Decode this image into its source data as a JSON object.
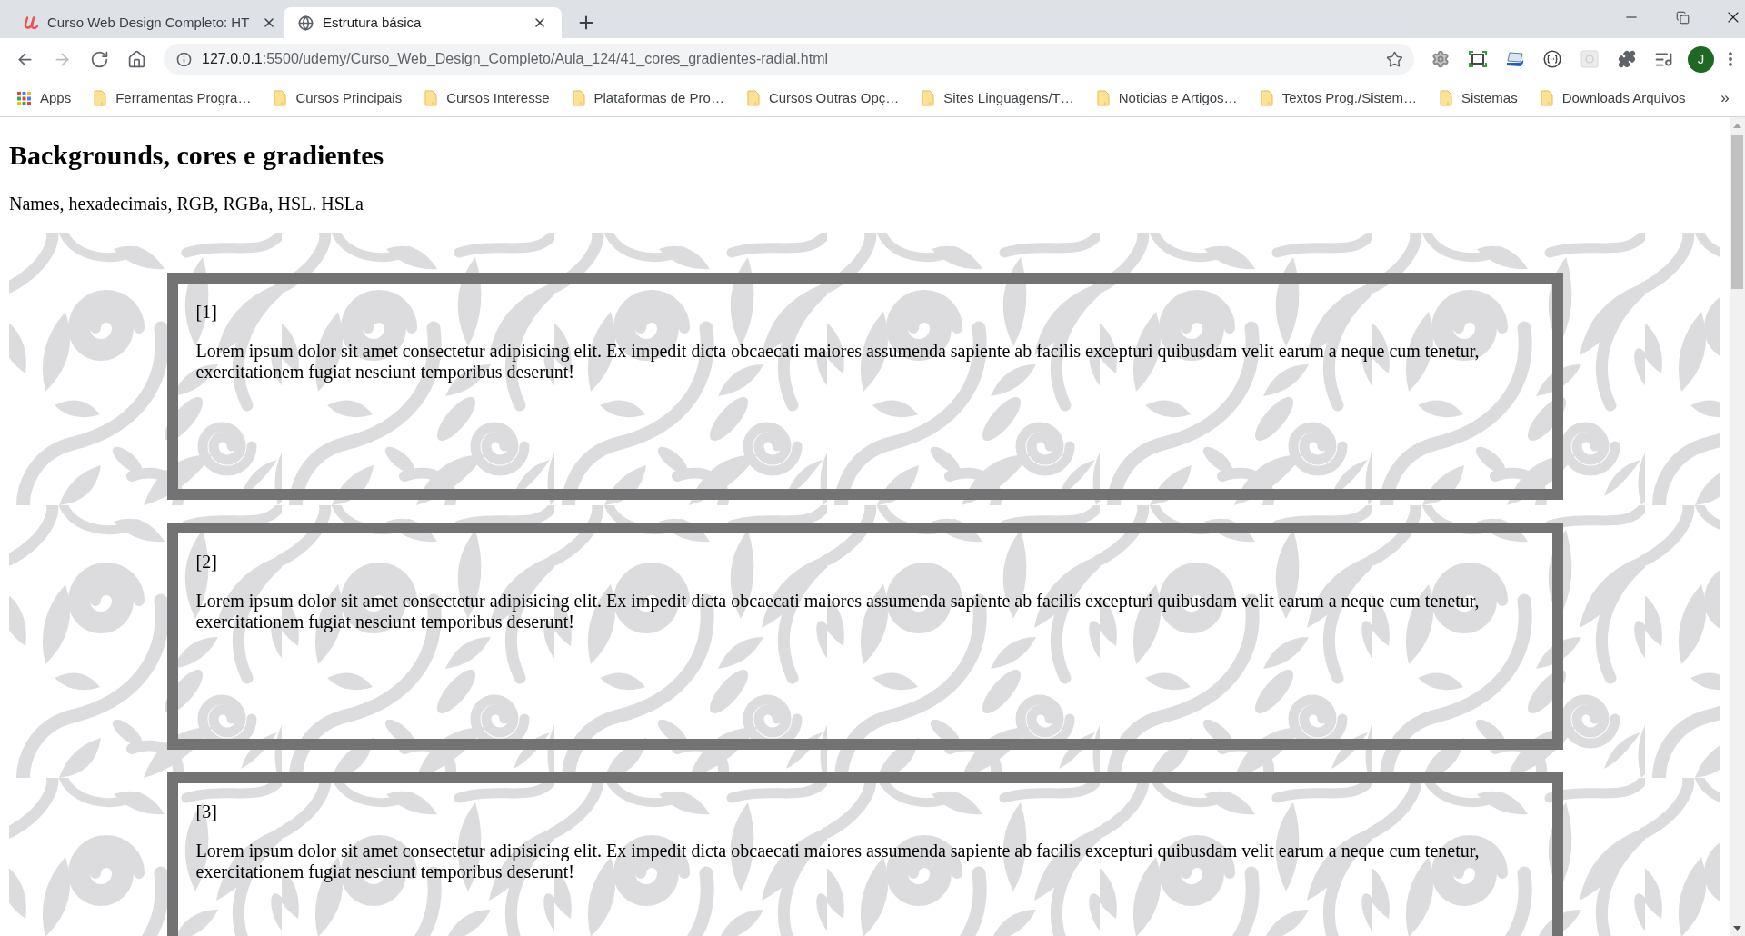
{
  "browser": {
    "tabs": [
      {
        "kind": "logo",
        "title": "Curso Web Design Completo: HT",
        "selected": false
      },
      {
        "kind": "globe",
        "title": "Estrutura básica",
        "selected": true
      }
    ],
    "nav_buttons": [
      {
        "kind": "back",
        "disabled": false
      },
      {
        "kind": "forward",
        "disabled": true
      },
      {
        "kind": "reload",
        "disabled": false
      },
      {
        "kind": "home",
        "disabled": false
      }
    ],
    "address": {
      "host": "127.0.0.1",
      "path": ":5500/udemy/Curso_Web_Design_Completo/Aula_124/41_cores_gradientes-radial.html"
    },
    "profile": {
      "initial": "J"
    },
    "bookmarks": {
      "apps": "Apps",
      "folders": [
        "Ferramentas Progra…",
        "Cursos Principais",
        "Cursos Interesse",
        "Plataformas de Pro…",
        "Cursos Outras Opç…",
        "Sites Linguagens/T…",
        "Noticias e Artigos…",
        "Textos Prog./Sistem…",
        "Sistemas",
        "Downloads Arquivos"
      ],
      "more": "»"
    }
  },
  "page": {
    "heading": "Backgrounds, cores e gradientes",
    "subtitle": "Names, hexadecimais, RGB, RGBa, HSL. HSLa",
    "boxes": [
      {
        "label": "[1]",
        "text": "Lorem ipsum dolor sit amet consectetur adipisicing elit. Ex impedit dicta obcaecati maiores assumenda sapiente ab facilis excepturi quibusdam velit earum a neque cum tenetur, exercitationem fugiat nesciunt temporibus deserunt!"
      },
      {
        "label": "[2]",
        "text": "Lorem ipsum dolor sit amet consectetur adipisicing elit. Ex impedit dicta obcaecati maiores assumenda sapiente ab facilis excepturi quibusdam velit earum a neque cum tenetur, exercitationem fugiat nesciunt temporibus deserunt!"
      },
      {
        "label": "[3]",
        "text": "Lorem ipsum dolor sit amet consectetur adipisicing elit. Ex impedit dicta obcaecati maiores assumenda sapiente ab facilis excepturi quibusdam velit earum a neque cum tenetur, exercitationem fugiat nesciunt temporibus deserunt!"
      }
    ]
  }
}
